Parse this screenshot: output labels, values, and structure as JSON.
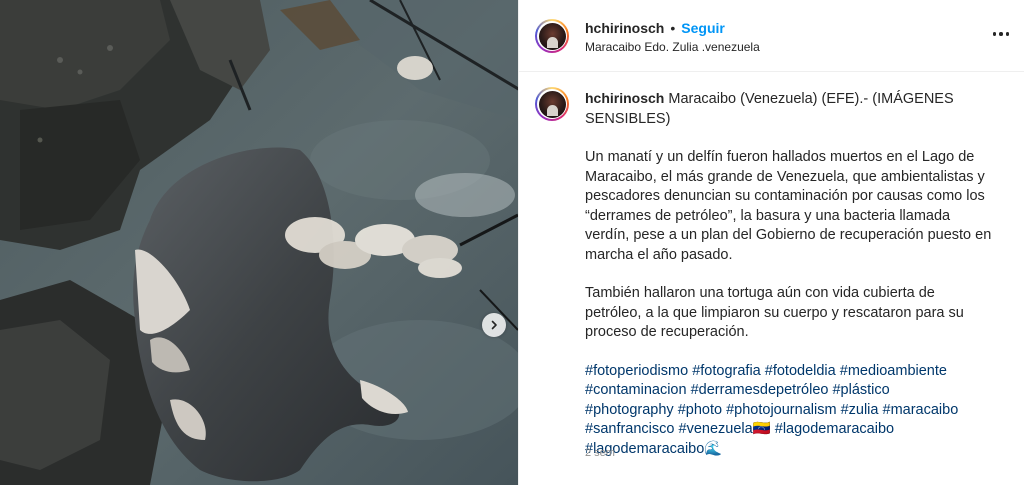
{
  "post": {
    "username": "hchirinosch",
    "follow_label": "Seguir",
    "separator": "•",
    "location": "Maracaibo Edo. Zulia .venezuela",
    "caption_head": "Maracaibo (Venezuela) (EFE).- (IMÁGENES SENSIBLES)",
    "caption_p1": "Un manatí y un delfín fueron hallados muertos en el Lago de Maracaibo, el más grande de Venezuela, que ambientalistas y pescadores denuncian su contaminación por causas como los “derrames de petróleo”, la basura y una bacteria llamada verdín, pese a un plan del Gobierno de recuperación puesto en marcha el año pasado.",
    "caption_p2": "También hallaron una tortuga aún con vida cubierta de petróleo, a la que limpiaron su cuerpo y rescataron para su proceso de recuperación.",
    "hashtags": [
      "#fotoperiodismo",
      "#fotografia",
      "#fotodeldia",
      "#medioambiente",
      "#contaminacion",
      "#derramesdepetróleo",
      "#plástico",
      "#photography",
      "#photo",
      "#photojournalism",
      "#zulia",
      "#maracaibo",
      "#sanfrancisco",
      "#venezuela🇻🇪",
      "#lagodemaracaibo",
      "#lagodemaracaibo🌊"
    ],
    "time_ago": "2 sem"
  },
  "icons": {
    "next": "chevron-right-icon",
    "more": "more-options-icon"
  }
}
